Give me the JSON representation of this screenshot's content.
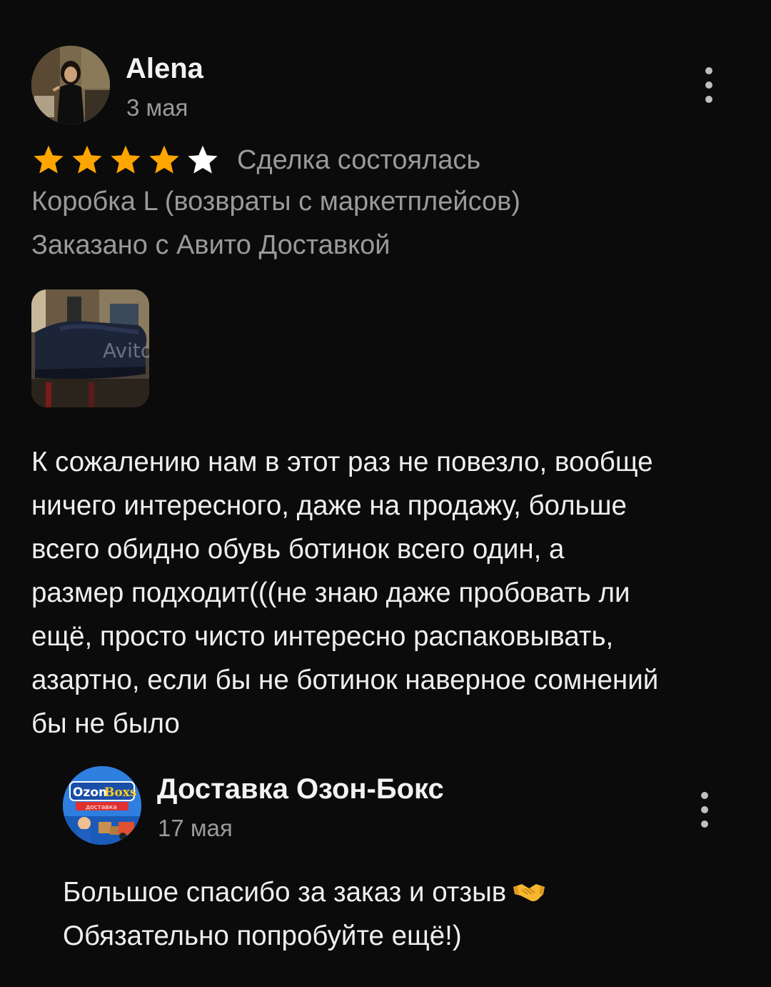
{
  "review": {
    "author_name": "Alena",
    "date": "3 мая",
    "rating": 4,
    "max_rating": 5,
    "deal_status": "Сделка состоялась",
    "product": "Коробка L (возвраты с маркетплейсов)",
    "delivery": "Заказано с Авито Доставкой",
    "text_lines": [
      "К сожалению нам в этот раз не повезло,  вообще",
      "ничего интересного,  даже на продажу,  больше",
      "всего обидно обувь ботинок всего один,  а",
      "размер подходит(((не знаю даже пробовать ли",
      "ещё,  просто чисто интересно распаковывать,",
      "азартно,  если бы не ботинок  наверное сомнений",
      "бы не было"
    ],
    "photo_watermark": "Avito",
    "colors": {
      "star_filled": "#ffa500",
      "star_empty": "#ffffff"
    },
    "icons": {
      "menu": "more-vertical-icon",
      "star": "star-icon"
    }
  },
  "reply": {
    "author_name": "Доставка Озон-Бокс",
    "date": "17 мая",
    "avatar_logo": {
      "word1": "Ozon",
      "word2": "Boxs",
      "ribbon": "доставка"
    },
    "text_line_1": "Большое спасибо за заказ и отзыв",
    "text_line_2": "Обязательно попробуйте ещё!)",
    "emoji": "handshake-icon"
  }
}
